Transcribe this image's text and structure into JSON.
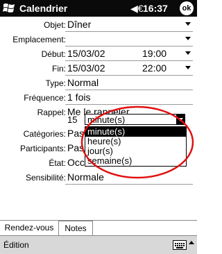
{
  "titlebar": {
    "title": "Calendrier",
    "speaker_icon": "speaker-icon",
    "time": "16:37",
    "ok_label": "ok"
  },
  "form": {
    "objet": {
      "label": "Objet:",
      "value": "Dîner"
    },
    "emplacement": {
      "label": "Emplacement:",
      "value": ""
    },
    "debut": {
      "label": "Début:",
      "date": "15/03/02",
      "time": "19:00"
    },
    "fin": {
      "label": "Fin:",
      "date": "15/03/02",
      "time": "22:00"
    },
    "type": {
      "label": "Type:",
      "value": "Normal"
    },
    "frequence": {
      "label": "Fréquence:",
      "value": "1 fois"
    },
    "rappel": {
      "label": "Rappel:",
      "value": "Me le rappeler",
      "count": "15",
      "unit": "minute(s)"
    },
    "categories": {
      "label": "Catégories:",
      "value": "Pas"
    },
    "participants": {
      "label": "Participants:",
      "value": "Pas"
    },
    "etat": {
      "label": "État:",
      "value": "Occu"
    },
    "sensibilite": {
      "label": "Sensibilité:",
      "value": "Normale"
    }
  },
  "dropdown": {
    "options": [
      "minute(s)",
      "heure(s)",
      "jour(s)",
      "semaine(s)"
    ],
    "selected_index": 0
  },
  "tabs": [
    {
      "label": "Rendez-vous"
    },
    {
      "label": "Notes"
    }
  ],
  "menubar": {
    "edit_label": "Édition"
  },
  "colors": {
    "titlebar": "#0a0a0a",
    "highlight": "#000000",
    "annotation": "#e01010"
  }
}
